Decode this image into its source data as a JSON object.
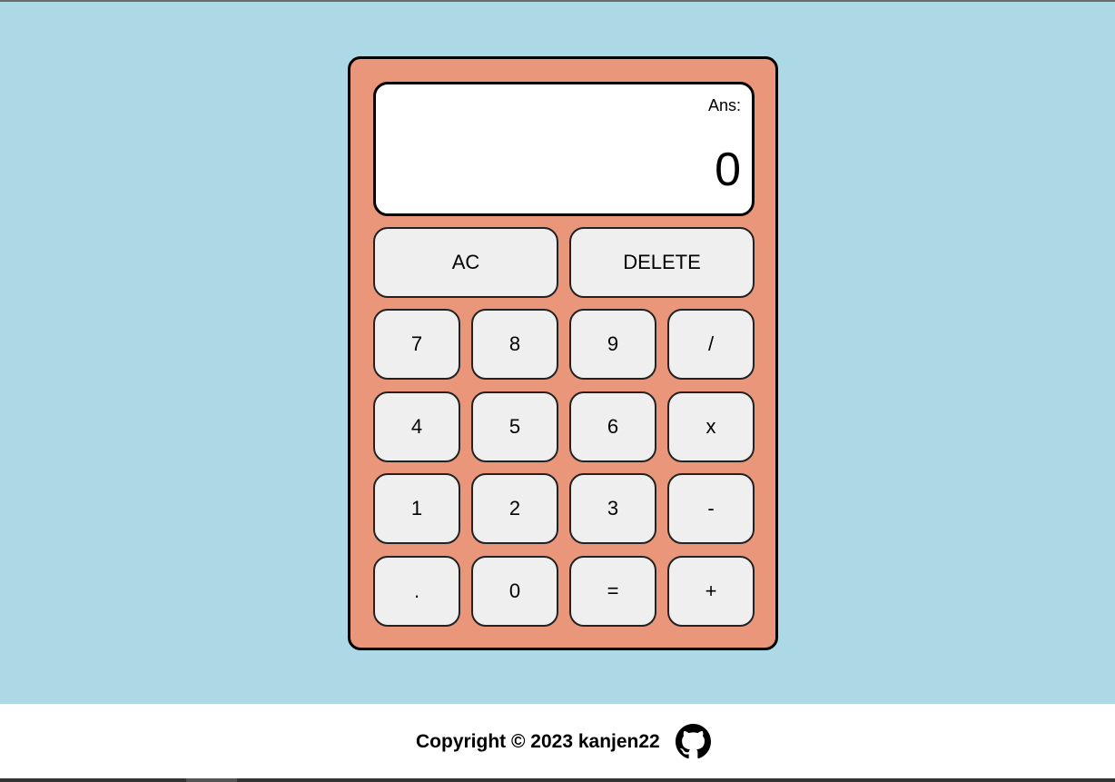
{
  "display": {
    "ans_label": "Ans:",
    "value": "0"
  },
  "buttons": {
    "ac": "AC",
    "delete": "DELETE",
    "seven": "7",
    "eight": "8",
    "nine": "9",
    "divide": "/",
    "four": "4",
    "five": "5",
    "six": "6",
    "multiply": "x",
    "one": "1",
    "two": "2",
    "three": "3",
    "minus": "-",
    "decimal": ".",
    "zero": "0",
    "equals": "=",
    "plus": "+"
  },
  "footer": {
    "copyright": "Copyright © 2023 kanjen22",
    "icon": "github-icon"
  },
  "colors": {
    "background": "#add8e6",
    "calculator_body": "#e9967a",
    "button": "#efefef",
    "display": "#ffffff"
  }
}
